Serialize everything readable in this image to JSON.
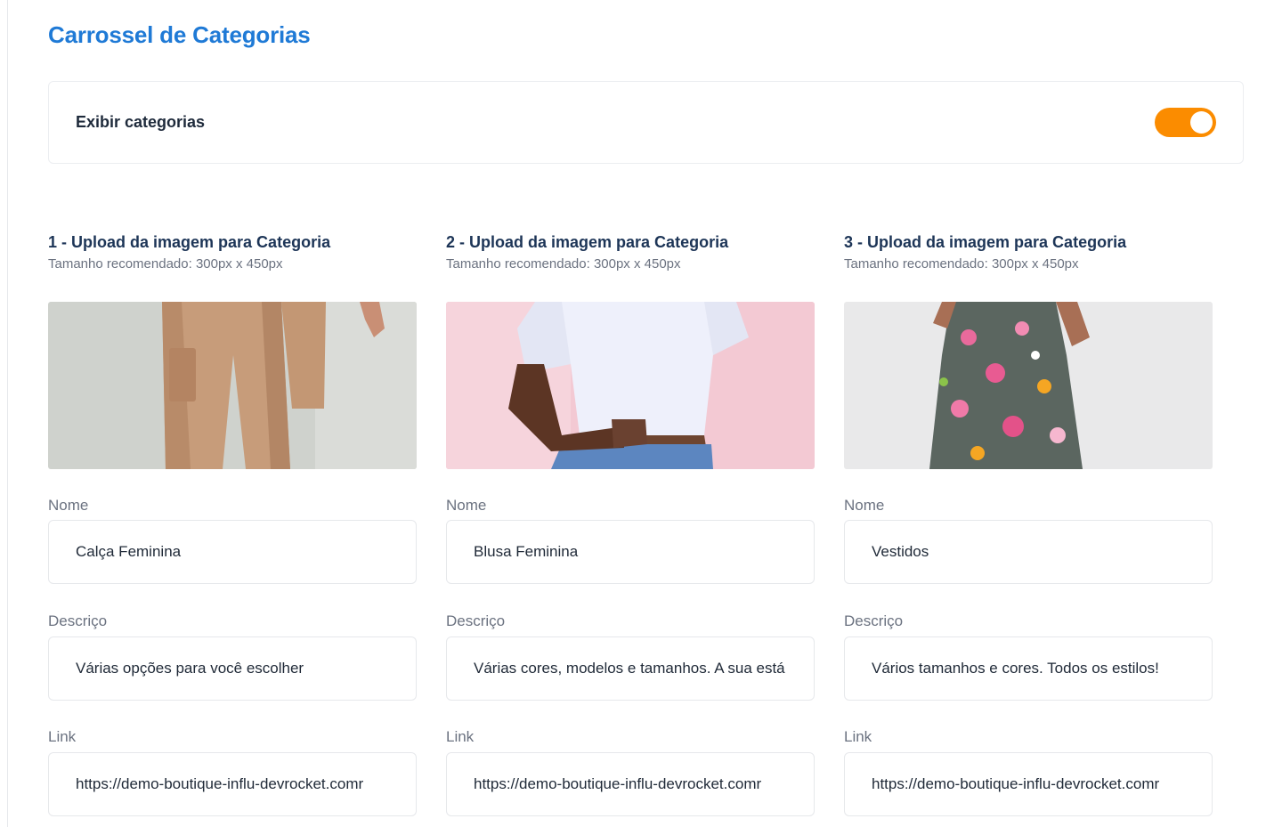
{
  "page": {
    "title": "Carrossel de Categorias"
  },
  "toggle": {
    "label": "Exibir categorias",
    "enabled": true,
    "color": "#fb8c00"
  },
  "labels": {
    "nome": "Nome",
    "descricao": "Descriço",
    "link": "Link"
  },
  "categories": [
    {
      "title": "1 - Upload da imagem para Categoria",
      "subtitle": "Tamanho recomendado: 300px x 450px",
      "image_name": "category-image-pants",
      "nome": "Calça Feminina",
      "descricao": "Várias opções para você escolher",
      "link": "https://demo-boutique-influ-devrocket.comr"
    },
    {
      "title": "2 - Upload da imagem para Categoria",
      "subtitle": "Tamanho recomendado: 300px x 450px",
      "image_name": "category-image-blouse",
      "nome": "Blusa Feminina",
      "descricao": "Várias cores, modelos e tamanhos. A sua está",
      "link": "https://demo-boutique-influ-devrocket.comr"
    },
    {
      "title": "3 - Upload da imagem para Categoria",
      "subtitle": "Tamanho recomendado: 300px x 450px",
      "image_name": "category-image-dress",
      "nome": "Vestidos",
      "descricao": "Vários tamanhos e cores. Todos os estilos!",
      "link": "https://demo-boutique-influ-devrocket.comr"
    }
  ]
}
